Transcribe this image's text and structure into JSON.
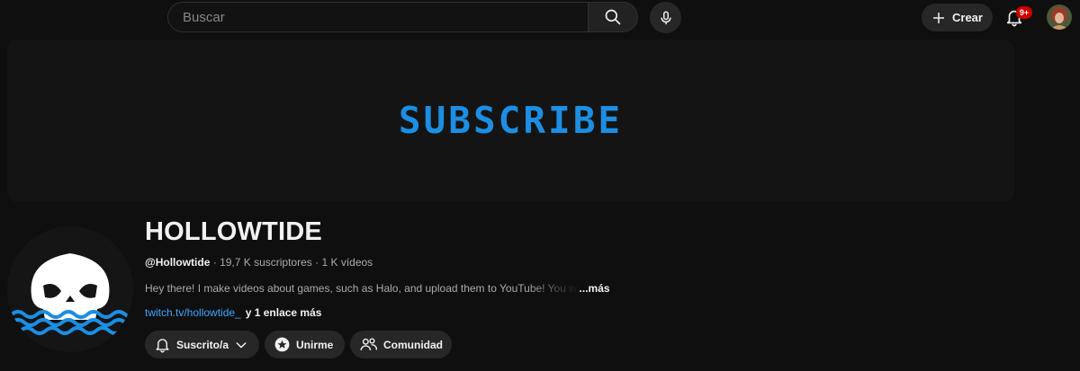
{
  "topbar": {
    "search_placeholder": "Buscar",
    "create_label": "Crear",
    "notification_count": "9+",
    "icons": [
      "search-icon",
      "mic-icon",
      "plus-icon",
      "bell-icon",
      "avatar"
    ]
  },
  "banner": {
    "text": "SUBSCRIBE",
    "text_color": "#1c8ee3"
  },
  "channel": {
    "name": "HOLLOWTIDE",
    "handle": "@Hollowtide",
    "subscribers": "19,7 K suscriptores",
    "videos": "1 K vídeos",
    "separator": "·",
    "description": "Hey there! I make videos about games, such as Halo, and upload them to YouTube! You wi",
    "more_label": "...más",
    "link": "twitch.tv/hollowtide_",
    "extra_links": "y 1 enlace más"
  },
  "actions": {
    "subscribed_label": "Suscrito/a",
    "join_label": "Unirme",
    "community_label": "Comunidad"
  },
  "colors": {
    "background": "#0f0f0f",
    "link": "#3ea6ff",
    "badge": "#cc0000"
  }
}
